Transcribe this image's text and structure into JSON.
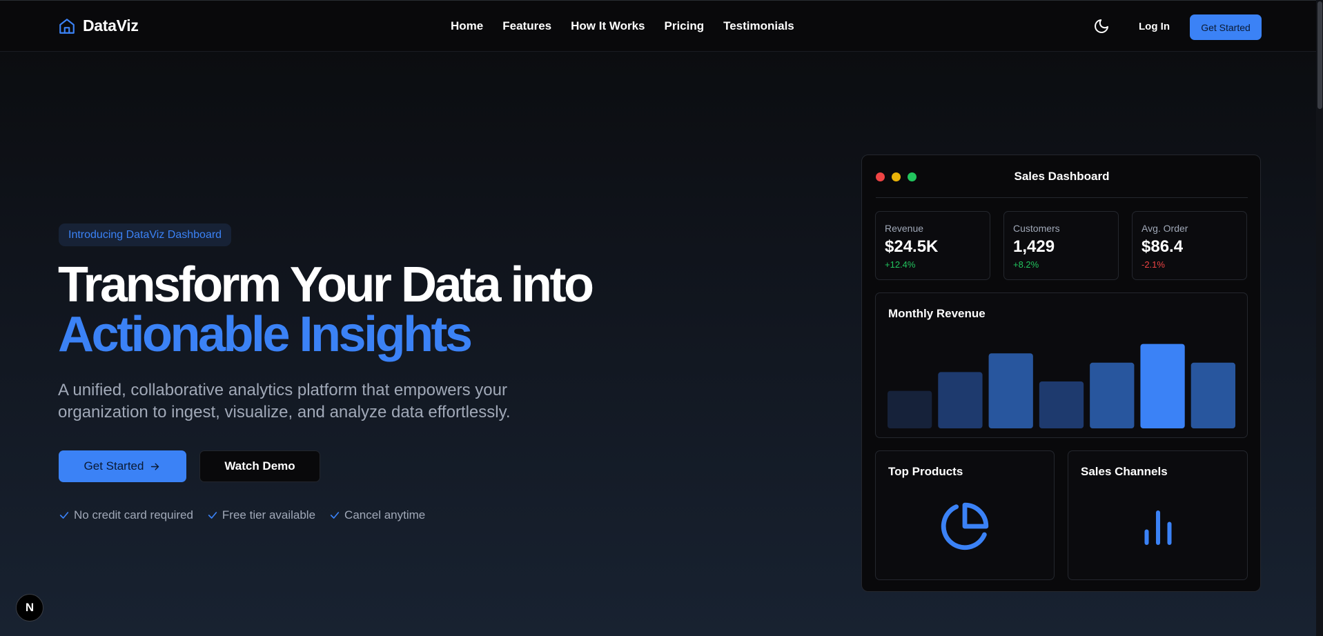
{
  "header": {
    "brand": "DataViz",
    "nav": [
      "Home",
      "Features",
      "How It Works",
      "Pricing",
      "Testimonials"
    ],
    "login_label": "Log In",
    "cta_label": "Get Started",
    "theme_icon": "moon-icon",
    "brand_color": "#3b82f6"
  },
  "hero": {
    "badge": "Introducing DataViz Dashboard",
    "title_line1": "Transform Your Data into",
    "title_line2": "Actionable Insights",
    "lead": "A unified, collaborative analytics platform that empowers your organization to ingest, visualize, and analyze data effortlessly.",
    "primary_cta": "Get Started",
    "secondary_cta": "Watch Demo",
    "perks": [
      "No credit card required",
      "Free tier available",
      "Cancel anytime"
    ]
  },
  "dashboard": {
    "title": "Sales Dashboard",
    "window_dot_colors": [
      "#ef4444",
      "#eab308",
      "#22c55e"
    ],
    "kpis": [
      {
        "label": "Revenue",
        "value": "$24.5K",
        "delta": "+12.4%",
        "trend": "up"
      },
      {
        "label": "Customers",
        "value": "1,429",
        "delta": "+8.2%",
        "trend": "up"
      },
      {
        "label": "Avg. Order",
        "value": "$86.4",
        "delta": "-2.1%",
        "trend": "down"
      }
    ],
    "monthly_revenue_title": "Monthly Revenue",
    "top_products_title": "Top Products",
    "top_products_icon": "pie-chart-icon",
    "sales_channels_title": "Sales Channels",
    "sales_channels_icon": "bar-chart-icon"
  },
  "chart_data": {
    "type": "bar",
    "title": "Monthly Revenue",
    "categories": [
      "",
      "",
      "",
      "",
      "",
      "",
      ""
    ],
    "values": [
      40,
      60,
      80,
      50,
      70,
      90,
      70
    ],
    "ylim": [
      0,
      100
    ],
    "bar_colors": [
      "#16223a",
      "#1e3a6e",
      "#28569e",
      "#1e3a6e",
      "#28569e",
      "#3b82f6",
      "#28569e"
    ],
    "grid": false
  },
  "footer_badge": "N"
}
